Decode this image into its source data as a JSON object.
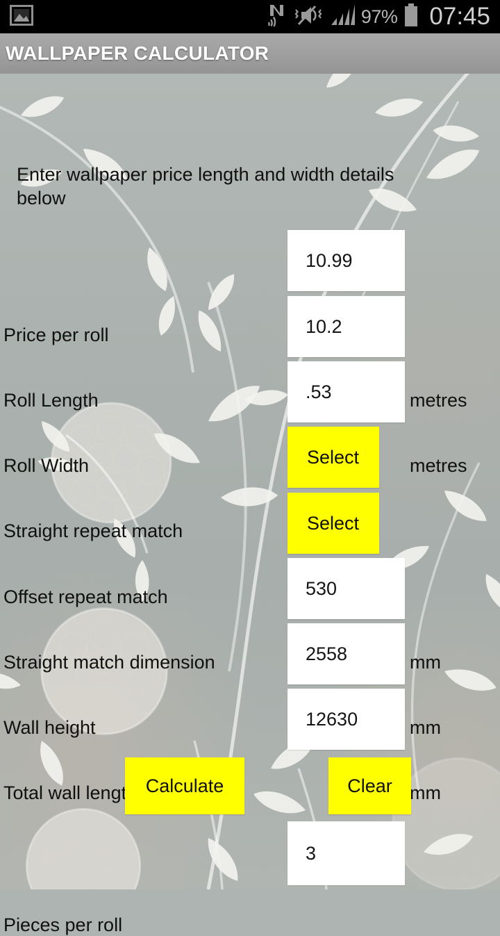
{
  "status_bar": {
    "icons": [
      "gallery-image-icon",
      "nfc-icon",
      "mute-vibrate-icon",
      "signal-bars-icon",
      "battery-icon"
    ],
    "battery_percent": "97%",
    "time": "07:45"
  },
  "title_bar": {
    "app_title": "WALLPAPER CALCULATOR"
  },
  "form": {
    "intro": "Enter wallpaper price length and width details below",
    "rows": [
      {
        "label": "Price per roll",
        "value": "10.99",
        "unit": "",
        "type": "input"
      },
      {
        "label": "Roll Length",
        "value": "10.2",
        "unit": "metres",
        "type": "input"
      },
      {
        "label": "Roll Width",
        "value": ".53",
        "unit": "metres",
        "type": "input"
      },
      {
        "label": "Straight repeat match",
        "value": "Select",
        "unit": "",
        "type": "button"
      },
      {
        "label": "Offset repeat match",
        "value": "Select",
        "unit": "",
        "type": "button"
      },
      {
        "label": "Straight match dimension",
        "value": "530",
        "unit": "mm",
        "type": "input"
      },
      {
        "label": "Wall height",
        "value": "2558",
        "unit": "mm",
        "type": "input"
      },
      {
        "label": "Total wall length",
        "value": "12630",
        "unit": "mm",
        "type": "input"
      }
    ],
    "calculate_label": "Calculate",
    "clear_label": "Clear",
    "result": {
      "label": "Pieces per roll",
      "value": "3"
    }
  },
  "colors": {
    "accent_yellow": "#ffff00",
    "field_white": "#ffffff",
    "title_bar_grey": "#9e9e9e",
    "background_grey_green": "#adb4b1",
    "status_bar_black": "#000000"
  }
}
